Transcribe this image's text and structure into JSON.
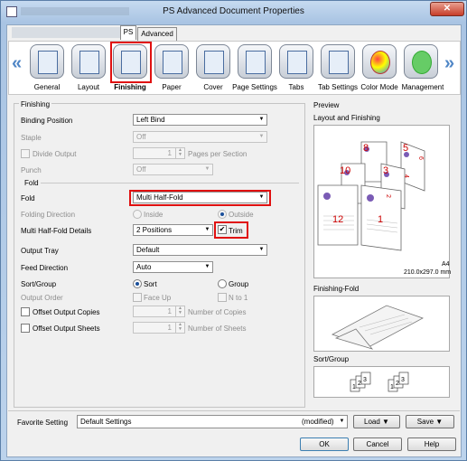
{
  "window": {
    "title": "PS Advanced Document Properties",
    "close_glyph": "✕"
  },
  "tabs": [
    {
      "label": "PS"
    },
    {
      "label": "Advanced"
    }
  ],
  "ribbon": {
    "items": [
      {
        "label": "General",
        "icon": "general-icon"
      },
      {
        "label": "Layout",
        "icon": "layout-icon"
      },
      {
        "label": "Finishing",
        "icon": "finishing-icon",
        "selected": true
      },
      {
        "label": "Paper",
        "icon": "paper-icon"
      },
      {
        "label": "Cover",
        "icon": "cover-icon"
      },
      {
        "label": "Page Settings",
        "icon": "page-settings-icon"
      },
      {
        "label": "Tabs",
        "icon": "tabs-icon"
      },
      {
        "label": "Tab Settings",
        "icon": "tab-settings-icon"
      },
      {
        "label": "Color Mode",
        "icon": "color-mode-icon"
      },
      {
        "label": "Management",
        "icon": "management-icon"
      }
    ],
    "left_arrow": "«",
    "right_arrow": "»"
  },
  "finishing": {
    "group_label": "Finishing",
    "binding_position": {
      "label": "Binding Position",
      "value": "Left Bind"
    },
    "staple": {
      "label": "Staple",
      "value": "Off"
    },
    "divide_output": {
      "label": "Divide Output",
      "value": "1",
      "unit": "Pages per Section"
    },
    "punch": {
      "label": "Punch",
      "value": "Off"
    },
    "fold_group_label": "Fold",
    "fold": {
      "label": "Fold",
      "value": "Multi Half-Fold"
    },
    "folding_direction": {
      "label": "Folding Direction",
      "inside": "Inside",
      "outside": "Outside"
    },
    "multi_half_fold_details": {
      "label": "Multi Half-Fold Details",
      "value": "2 Positions",
      "trim": "Trim",
      "trim_checked": true
    },
    "output_tray": {
      "label": "Output Tray",
      "value": "Default"
    },
    "feed_direction": {
      "label": "Feed Direction",
      "value": "Auto"
    },
    "sort_group": {
      "label": "Sort/Group",
      "sort": "Sort",
      "group": "Group"
    },
    "output_order": {
      "label": "Output Order",
      "face_up": "Face Up",
      "n_to_1": "N to 1"
    },
    "offset_output_copies": {
      "label": "Offset Output Copies",
      "value": "1",
      "unit": "Number of Copies"
    },
    "offset_output_sheets": {
      "label": "Offset Output Sheets",
      "value": "1",
      "unit": "Number of Sheets"
    }
  },
  "preview": {
    "group_label": "Preview",
    "layout_label": "Layout and Finishing",
    "page_numbers": [
      "8",
      "5",
      "10",
      "3",
      "12",
      "1",
      "6",
      "2",
      "4"
    ],
    "paper_size": "A4",
    "paper_dims": "210.0x297.0 mm",
    "finishing_fold_label": "Finishing-Fold",
    "sort_group_label": "Sort/Group",
    "sort_digits": [
      "1",
      "2",
      "3"
    ]
  },
  "footer": {
    "favorite_label": "Favorite Setting",
    "favorite_value": "Default Settings",
    "modified": "(modified)",
    "load": "Load",
    "save": "Save",
    "ok": "OK",
    "cancel": "Cancel",
    "help": "Help"
  }
}
